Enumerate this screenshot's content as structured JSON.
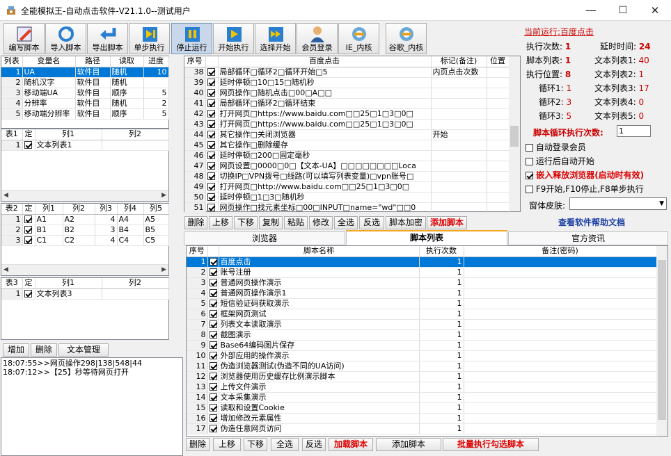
{
  "window": {
    "title": "全能模拟王-自动点击软件-V21.1.0--测试用户",
    "min": "—",
    "max": "☐",
    "close": "✕"
  },
  "toolbar": [
    {
      "label": "编写脚本",
      "icon": "pencil-icon"
    },
    {
      "label": "导入脚本",
      "icon": "refresh-icon"
    },
    {
      "label": "导出脚本",
      "icon": "return-arrow-icon"
    },
    {
      "label": "单步执行",
      "icon": "step-icon"
    },
    {
      "label": "停止运行",
      "icon": "pause-icon"
    },
    {
      "label": "开始执行",
      "icon": "play-icon"
    },
    {
      "label": "选择开始",
      "icon": "fast-forward-icon"
    },
    {
      "label": "会员登录",
      "icon": "user-icon"
    },
    {
      "label": "IE_内核",
      "icon": "ie-icon"
    },
    {
      "label": "谷歌_内核",
      "icon": "chrome-icon"
    }
  ],
  "list_table": {
    "headers": [
      "列表",
      "变量名",
      "路径",
      "读取",
      "进度"
    ],
    "rows": [
      [
        "1",
        "UA",
        "软件目",
        "随机",
        "10"
      ],
      [
        "2",
        "随机汉字",
        "软件目",
        "随机",
        ""
      ],
      [
        "3",
        "移动端UA",
        "软件目",
        "顺序",
        "5"
      ],
      [
        "4",
        "分辨率",
        "软件目",
        "随机",
        "2"
      ],
      [
        "5",
        "移动端分辨率",
        "软件目",
        "顺序",
        "5"
      ]
    ]
  },
  "table1": {
    "headers": [
      "表1",
      "定",
      "列1",
      "列2"
    ],
    "rows": [
      [
        "1",
        "文本列表1",
        ""
      ]
    ]
  },
  "table2": {
    "headers": [
      "表2",
      "定",
      "列1",
      "列2",
      "列3",
      "列4",
      "列5"
    ],
    "rows": [
      [
        "1",
        "A1",
        "A2",
        "4",
        "A4",
        "A5"
      ],
      [
        "2",
        "B1",
        "B2",
        "3",
        "B4",
        "B5"
      ],
      [
        "3",
        "C1",
        "C2",
        "4",
        "C4",
        "C5"
      ]
    ]
  },
  "table3": {
    "headers": [
      "表3",
      "定",
      "列1",
      "列2"
    ],
    "rows": [
      [
        "1",
        "文本列表3",
        ""
      ]
    ]
  },
  "left_buttons": {
    "add": "增加",
    "delete": "删除",
    "text_manage": "文本管理"
  },
  "log": [
    "18:07:55>>网页操作298|138|548|44",
    "18:07:12>>【25】秒等待网页打开"
  ],
  "script_table": {
    "headers": [
      "序号",
      "百度点击",
      "标记(备注)",
      "位置"
    ],
    "rows": [
      [
        "38",
        "局部循环□循环2□循环开始□5",
        "内页点击次数",
        ""
      ],
      [
        "39",
        "延时停顿□10□15□随机秒",
        "",
        ""
      ],
      [
        "40",
        "网页操作□随机点击□00□A□□",
        "",
        ""
      ],
      [
        "41",
        "局部循环□循环2□循环结束",
        "",
        ""
      ],
      [
        "42",
        "打开网页□https://www.baidu.com□□25□1□3□0□",
        "",
        ""
      ],
      [
        "43",
        "打开网页□https://www.baidu.com□□25□1□3□0□",
        "",
        ""
      ],
      [
        "44",
        "其它操作□关闭浏览器",
        "开始",
        ""
      ],
      [
        "45",
        "其它操作□删除缓存",
        "",
        ""
      ],
      [
        "46",
        "延时停顿□200□固定毫秒",
        "",
        ""
      ],
      [
        "47",
        "网页设置□0000□0□【文本-UA】□□□□□□□□Loca",
        "",
        ""
      ],
      [
        "48",
        "切换IP□VPN拨号□线路(可以填写列表变量)□vpn账号□",
        "",
        ""
      ],
      [
        "49",
        "打开网页□http://www.baidu.com□□25□1□3□0□",
        "",
        ""
      ],
      [
        "50",
        "延时停顿□1□3□随机秒",
        "",
        ""
      ],
      [
        "51",
        "网页操作□找元素坐标□00□INPUT□name=\"wd\"□□0",
        "",
        ""
      ]
    ]
  },
  "mid_buttons": [
    "删除",
    "上移",
    "下移",
    "复制",
    "粘贴",
    "修改",
    "全选",
    "反选",
    "脚本加密",
    "添加脚本"
  ],
  "right": {
    "current_label": "当前运行:",
    "current_value": "百度点击",
    "exec_count_label": "执行次数:",
    "exec_count": "1",
    "delay_label": "延时时间:",
    "delay": "24",
    "script_list_label": "脚本列表:",
    "script_list": "1",
    "text_list1_label": "文本列表1:",
    "text_list1": "40",
    "exec_pos_label": "执行位置:",
    "exec_pos": "8",
    "text_list2_label": "文本列表2:",
    "text_list2": "1",
    "loop1_label": "循环1:",
    "loop1": "1",
    "text_list3_label": "文本列表3:",
    "text_list3": "17",
    "loop2_label": "循环2:",
    "loop2": "3",
    "text_list4_label": "文本列表4:",
    "text_list4": "0",
    "loop3_label": "循环3:",
    "loop3": "5",
    "text_list5_label": "文本列表5:",
    "text_list5": "0",
    "loop_count_label": "脚本循环执行次数:",
    "loop_count": "1",
    "auto_login": "自动登录会员",
    "auto_start": "运行后自动开始",
    "embed_browser": "嵌入释放浏览器(启动时有效)",
    "hotkeys": "F9开始,F10停止,F8单步执行",
    "skin_label": "窗体皮肤:",
    "help": "查看软件帮助文档"
  },
  "tabs": [
    "浏览器",
    "脚本列表",
    "官方资讯"
  ],
  "script_list": {
    "headers": [
      "序号",
      "脚本名称",
      "执行次数",
      "备注(密码)"
    ],
    "rows": [
      [
        "1",
        "百度点击",
        "1"
      ],
      [
        "2",
        "账号注册",
        "1"
      ],
      [
        "3",
        "普通网页操作演示",
        "1"
      ],
      [
        "4",
        "普通网页操作演示1",
        "1"
      ],
      [
        "5",
        "短信验证码获取演示",
        "1"
      ],
      [
        "6",
        "框架网页测试",
        "1"
      ],
      [
        "7",
        "列表文本读取演示",
        "1"
      ],
      [
        "8",
        "截图演示",
        "1"
      ],
      [
        "9",
        "Base64编码图片保存",
        "1"
      ],
      [
        "10",
        "外部应用的操作演示",
        "1"
      ],
      [
        "11",
        "伪造浏览器测试(伪造不同的UA访问)",
        "1"
      ],
      [
        "12",
        "浏览器使用历史缓存比例演示脚本",
        "1"
      ],
      [
        "13",
        "上传文件演示",
        "1"
      ],
      [
        "14",
        "文本采集演示",
        "1"
      ],
      [
        "15",
        "读取和设置Cookie",
        "1"
      ],
      [
        "16",
        "增加修改元素属性",
        "1"
      ],
      [
        "17",
        "伪造任意网页访问",
        "1"
      ]
    ]
  },
  "bottom_buttons": [
    "删除",
    "上移",
    "下移",
    "全选",
    "反选",
    "加载脚本",
    "添加脚本",
    "批量执行勾选脚本"
  ]
}
